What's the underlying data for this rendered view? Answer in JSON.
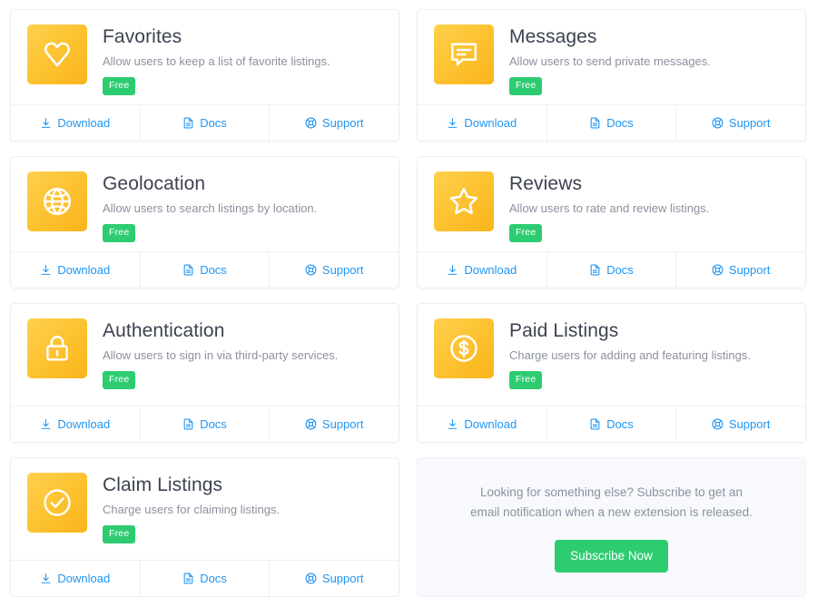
{
  "theme": {
    "page_background": "#ffffff",
    "card_background": "#ffffff",
    "card_border": "#eceef3",
    "title_color": "#3d4251",
    "description_color": "#8d919f",
    "link_color": "#2196f3",
    "badge_green": "#2ecc71",
    "icon_tile_gradient_from": "#fed14e",
    "icon_tile_gradient_to": "#f9b41b",
    "subscribe_panel_background": "#f7f9fc"
  },
  "footer_actions": {
    "download": {
      "label": "Download",
      "icon": "download-icon"
    },
    "docs": {
      "label": "Docs",
      "icon": "document-icon"
    },
    "support": {
      "label": "Support",
      "icon": "life-ring-icon"
    }
  },
  "cards": [
    {
      "title": "Favorites",
      "description": "Allow users to keep a list of favorite listings.",
      "badge": "Free",
      "icon": "heart-icon"
    },
    {
      "title": "Messages",
      "description": "Allow users to send private messages.",
      "badge": "Free",
      "icon": "chat-bubble-icon"
    },
    {
      "title": "Geolocation",
      "description": "Allow users to search listings by location.",
      "badge": "Free",
      "icon": "globe-icon"
    },
    {
      "title": "Reviews",
      "description": "Allow users to rate and review listings.",
      "badge": "Free",
      "icon": "star-icon"
    },
    {
      "title": "Authentication",
      "description": "Allow users to sign in via third-party services.",
      "badge": "Free",
      "icon": "lock-icon"
    },
    {
      "title": "Paid Listings",
      "description": "Charge users for adding and featuring listings.",
      "badge": "Free",
      "icon": "dollar-circle-icon"
    },
    {
      "title": "Claim Listings",
      "description": "Charge users for claiming listings.",
      "badge": "Free",
      "icon": "check-circle-icon"
    }
  ],
  "subscribe_panel": {
    "text": "Looking for something else? Subscribe to get an email notification when a new extension is released.",
    "button_label": "Subscribe Now"
  }
}
